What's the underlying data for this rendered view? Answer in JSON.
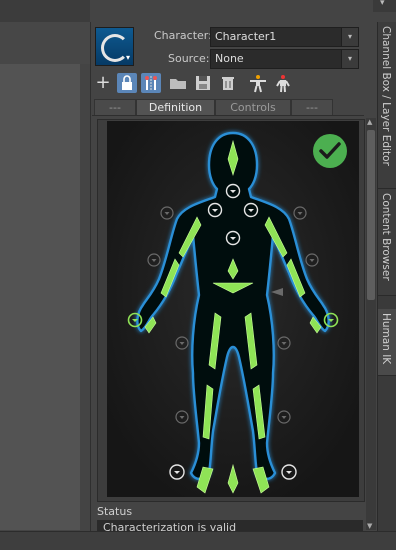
{
  "menu": {
    "expand_glyph": "▾"
  },
  "hik": {
    "character_label": "Character:",
    "character_value": "Character1",
    "source_label": "Source:",
    "source_value": "None",
    "dropdown_arrow": "▾",
    "tabs": [
      "---",
      "Definition",
      "Controls",
      "---"
    ],
    "selected_tab": "Definition",
    "status_label": "Status",
    "status_text": "Characterization is valid",
    "valid_color": "#4caf50",
    "bone_color": "#8fe356",
    "skin_outline_color": "#2a8fd6"
  },
  "toolbar": {
    "icons": [
      "add-icon",
      "lock-icon",
      "mirror-icon",
      "open-folder-icon",
      "save-icon",
      "delete-icon",
      "t-pose-figure-icon",
      "skeleton-figure-icon"
    ],
    "add_glyph": "+"
  },
  "side_tabs": [
    "Channel Box / Layer Editor",
    "Content Browser",
    "Human IK"
  ],
  "selected_side_tab": "Human IK"
}
